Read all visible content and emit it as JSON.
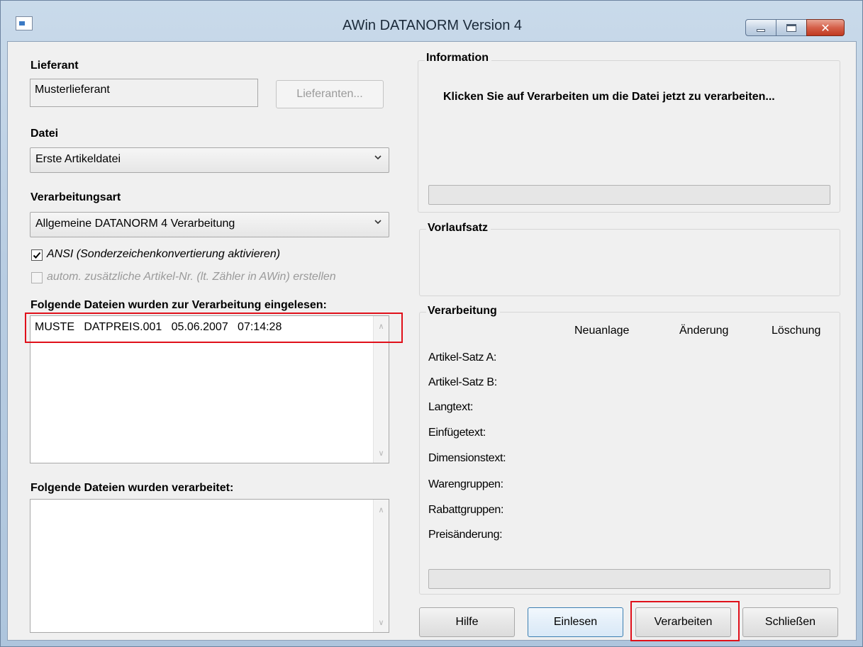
{
  "window": {
    "title": "AWin  DATANORM Version 4",
    "controls": {
      "minimize": "minimize",
      "maximize": "maximize",
      "close": "✕"
    }
  },
  "lieferant": {
    "label": "Lieferant",
    "value": "Musterlieferant",
    "button": "Lieferanten..."
  },
  "datei": {
    "label": "Datei",
    "selected": "Erste Artikeldatei"
  },
  "verarbeitungsart": {
    "label": "Verarbeitungsart",
    "selected": "Allgemeine DATANORM 4 Verarbeitung"
  },
  "options": {
    "ansi_label": "ANSI (Sonderzeichenkonvertierung aktivieren)",
    "ansi_checked": true,
    "artnr_label": "autom. zusätzliche Artikel-Nr. (lt. Zähler in AWin) erstellen",
    "artnr_checked": false
  },
  "eingelesen": {
    "label": "Folgende Dateien wurden zur Verarbeitung eingelesen:",
    "items": [
      "MUSTE   DATPREIS.001   05.06.2007   07:14:28"
    ]
  },
  "verarbeitet": {
    "label": "Folgende Dateien wurden verarbeitet:",
    "items": []
  },
  "information": {
    "title": "Information",
    "message": "Klicken Sie auf Verarbeiten um die Datei jetzt zu verarbeiten...",
    "progress": 0
  },
  "vorlaufsatz": {
    "title": "Vorlaufsatz"
  },
  "verarbeitung": {
    "title": "Verarbeitung",
    "columns": [
      "Neuanlage",
      "Änderung",
      "Löschung"
    ],
    "rows": [
      "Artikel-Satz A:",
      "Artikel-Satz B:",
      "Langtext:",
      "Einfügetext:",
      "Dimensionstext:",
      "Warengruppen:",
      "Rabattgruppen:",
      "Preisänderung:"
    ],
    "progress": 0
  },
  "buttons": {
    "hilfe": "Hilfe",
    "einlesen": "Einlesen",
    "verarbeiten": "Verarbeiten",
    "schliessen": "Schließen"
  },
  "icons": {
    "app": "app-icon",
    "chevron": "chevron-down-icon",
    "scroll_up": "scroll-up-icon",
    "scroll_down": "scroll-down-icon",
    "check": "checkmark-icon"
  },
  "colors": {
    "highlight": "#e0101a",
    "title_gradient": "#b9cde2",
    "close_button": "#c0391f"
  }
}
